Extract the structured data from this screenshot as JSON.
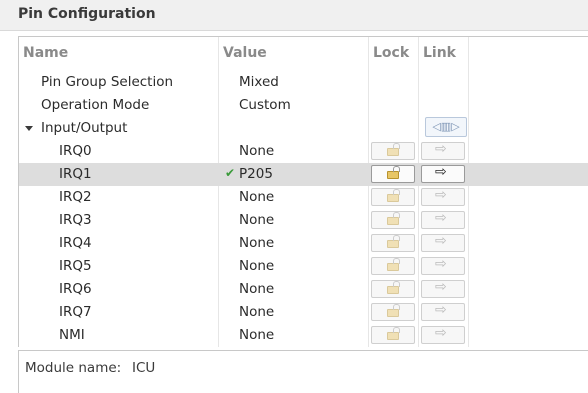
{
  "title": "Pin Configuration",
  "columns": {
    "name": "Name",
    "value": "Value",
    "lock": "Lock",
    "link": "Link"
  },
  "rows": [
    {
      "name": "Pin Group Selection",
      "value": "Mixed"
    },
    {
      "name": "Operation Mode",
      "value": "Custom"
    },
    {
      "name": "Input/Output",
      "value": "",
      "expanded": true
    },
    {
      "name": "IRQ0",
      "value": "None"
    },
    {
      "name": "IRQ1",
      "value": "P205",
      "selected": true,
      "valid": true
    },
    {
      "name": "IRQ2",
      "value": "None"
    },
    {
      "name": "IRQ3",
      "value": "None"
    },
    {
      "name": "IRQ4",
      "value": "None"
    },
    {
      "name": "IRQ5",
      "value": "None"
    },
    {
      "name": "IRQ6",
      "value": "None"
    },
    {
      "name": "IRQ7",
      "value": "None"
    },
    {
      "name": "NMI",
      "value": "None"
    }
  ],
  "icons": {
    "expand": "triangle-down-icon",
    "lock": "padlock-icon",
    "link": "right-arrow-icon",
    "group_link": "link-group-icon",
    "valid": "checkmark-icon"
  },
  "glyphs": {
    "arrow": "⇨",
    "check": "✔",
    "group": "◁▥▷"
  },
  "module": {
    "label": "Module name:",
    "value": "ICU"
  }
}
